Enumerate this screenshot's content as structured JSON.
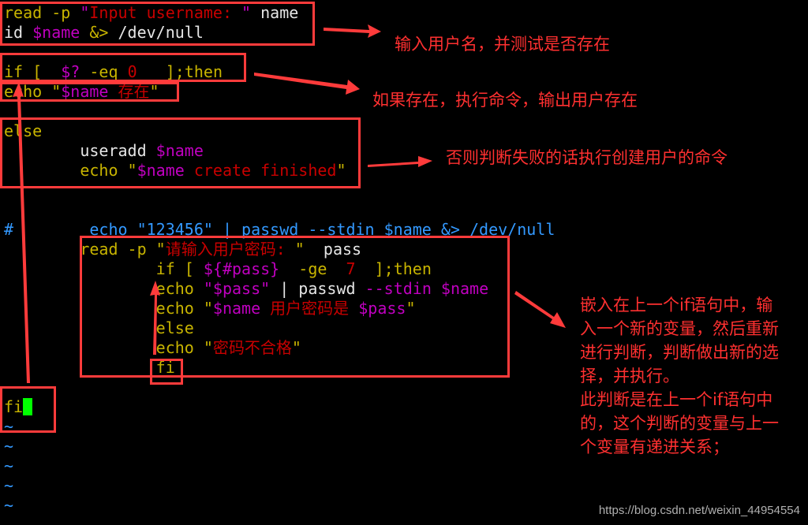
{
  "editor": {
    "lines": [
      [
        {
          "t": "read -p ",
          "c": "kw"
        },
        {
          "t": "\"",
          "c": "var"
        },
        {
          "t": "Input username: ",
          "c": "str"
        },
        {
          "t": "\"",
          "c": "var"
        },
        {
          "t": " name",
          "c": "plain"
        }
      ],
      [
        {
          "t": "id ",
          "c": "plain"
        },
        {
          "t": "$name",
          "c": "var"
        },
        {
          "t": " &> ",
          "c": "kw"
        },
        {
          "t": "/dev/null",
          "c": "plain"
        }
      ],
      [],
      [
        {
          "t": "if [  ",
          "c": "kw"
        },
        {
          "t": "$?",
          "c": "var"
        },
        {
          "t": " -eq ",
          "c": "kw"
        },
        {
          "t": "0",
          "c": "num"
        },
        {
          "t": "   ];then",
          "c": "kw"
        }
      ],
      [
        {
          "t": "echo ",
          "c": "kw"
        },
        {
          "t": "\"",
          "c": "kw"
        },
        {
          "t": "$name",
          "c": "var"
        },
        {
          "t": " 存在",
          "c": "str"
        },
        {
          "t": "\"",
          "c": "kw"
        }
      ],
      [],
      [
        {
          "t": "else",
          "c": "kw"
        }
      ],
      [
        {
          "t": "        useradd ",
          "c": "plain"
        },
        {
          "t": "$name",
          "c": "var"
        }
      ],
      [
        {
          "t": "        echo ",
          "c": "kw"
        },
        {
          "t": "\"",
          "c": "kw"
        },
        {
          "t": "$name",
          "c": "var"
        },
        {
          "t": " create finished",
          "c": "str"
        },
        {
          "t": "\"",
          "c": "kw"
        }
      ],
      [],
      [],
      [
        {
          "t": "#        echo \"123456\" | passwd --stdin $name &> /dev/null",
          "c": "cmt"
        }
      ],
      [
        {
          "t": "        read -p ",
          "c": "kw"
        },
        {
          "t": "\"",
          "c": "kw"
        },
        {
          "t": "请输入用户密码: ",
          "c": "str"
        },
        {
          "t": "\"",
          "c": "kw"
        },
        {
          "t": "  pass",
          "c": "plain"
        }
      ],
      [
        {
          "t": "                if [ ",
          "c": "kw"
        },
        {
          "t": "${#pass}",
          "c": "var"
        },
        {
          "t": "  -ge  ",
          "c": "kw"
        },
        {
          "t": "7",
          "c": "num"
        },
        {
          "t": "  ];then",
          "c": "kw"
        }
      ],
      [
        {
          "t": "                echo ",
          "c": "kw"
        },
        {
          "t": "\"$pass\"",
          "c": "var"
        },
        {
          "t": " | passwd ",
          "c": "plain"
        },
        {
          "t": "--stdin $name",
          "c": "var"
        }
      ],
      [
        {
          "t": "                echo ",
          "c": "kw"
        },
        {
          "t": "\"",
          "c": "kw"
        },
        {
          "t": "$name",
          "c": "var"
        },
        {
          "t": " 用户密码是 ",
          "c": "str"
        },
        {
          "t": "$pass",
          "c": "var"
        },
        {
          "t": "\"",
          "c": "kw"
        }
      ],
      [
        {
          "t": "                else",
          "c": "kw"
        }
      ],
      [
        {
          "t": "                echo ",
          "c": "kw"
        },
        {
          "t": "\"",
          "c": "kw"
        },
        {
          "t": "密码不合格",
          "c": "str"
        },
        {
          "t": "\"",
          "c": "kw"
        }
      ],
      [
        {
          "t": "                fi",
          "c": "kw"
        }
      ],
      [],
      [
        {
          "t": "fi",
          "c": "kw"
        },
        {
          "cursor": true
        }
      ],
      [
        {
          "t": "~",
          "c": "tilde"
        }
      ],
      [
        {
          "t": "~",
          "c": "tilde"
        }
      ],
      [
        {
          "t": "~",
          "c": "tilde"
        }
      ],
      [
        {
          "t": "~",
          "c": "tilde"
        }
      ],
      [
        {
          "t": "~",
          "c": "tilde"
        }
      ]
    ]
  },
  "annotations": {
    "a1": "输入用户名，并测试是否存在",
    "a2": "如果存在，执行命令，输出用户存在",
    "a3": "否则判断失败的话执行创建用户的命令",
    "a4": [
      "嵌入在上一个if语句中，输",
      "入一个新的变量，然后重新",
      "进行判断，判断做出新的选",
      "择，并执行。",
      "此判断是在上一个if语句中",
      "的，这个判断的变量与上一",
      "个变量有递进关系；"
    ]
  },
  "colors": {
    "annotation": "#ff3030",
    "keyword": "#c8b400",
    "variable": "#c000c0",
    "string": "#c80000",
    "comment": "#3399ff",
    "cursor": "#00ff00"
  },
  "watermark": "https://blog.csdn.net/weixin_44954554"
}
